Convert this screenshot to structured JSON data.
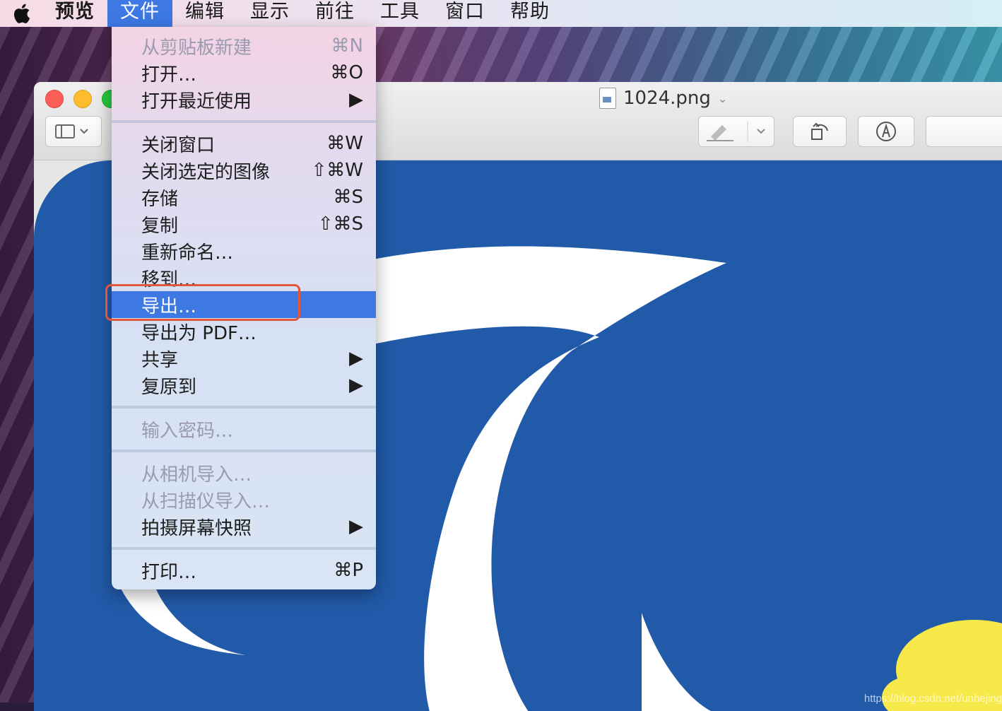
{
  "menubar": {
    "items": [
      {
        "label": "预览"
      },
      {
        "label": "文件"
      },
      {
        "label": "编辑"
      },
      {
        "label": "显示"
      },
      {
        "label": "前往"
      },
      {
        "label": "工具"
      },
      {
        "label": "窗口"
      },
      {
        "label": "帮助"
      }
    ]
  },
  "window": {
    "title": "1024.png"
  },
  "file_menu": {
    "items": [
      {
        "label": "从剪贴板新建",
        "shortcut": "⌘N"
      },
      {
        "label": "打开…",
        "shortcut": "⌘O"
      },
      {
        "label": "打开最近使用",
        "shortcut": "▶"
      },
      {
        "label": "关闭窗口",
        "shortcut": "⌘W"
      },
      {
        "label": "关闭选定的图像",
        "shortcut": "⇧⌘W"
      },
      {
        "label": "存储",
        "shortcut": "⌘S"
      },
      {
        "label": "复制",
        "shortcut": "⇧⌘S"
      },
      {
        "label": "重新命名…",
        "shortcut": ""
      },
      {
        "label": "移到…",
        "shortcut": ""
      },
      {
        "label": "导出…",
        "shortcut": ""
      },
      {
        "label": "导出为 PDF…",
        "shortcut": ""
      },
      {
        "label": "共享",
        "shortcut": "▶"
      },
      {
        "label": "复原到",
        "shortcut": "▶"
      },
      {
        "label": "输入密码…",
        "shortcut": ""
      },
      {
        "label": "从相机导入…",
        "shortcut": ""
      },
      {
        "label": "从扫描仪导入…",
        "shortcut": ""
      },
      {
        "label": "拍摄屏幕快照",
        "shortcut": "▶"
      },
      {
        "label": "打印…",
        "shortcut": "⌘P"
      }
    ]
  },
  "watermark": "https://blog.csdn.net/unhejing",
  "colors": {
    "selection": "#3d78e3",
    "highlight_outline": "#e2563a",
    "image_background": "#215aa8"
  }
}
